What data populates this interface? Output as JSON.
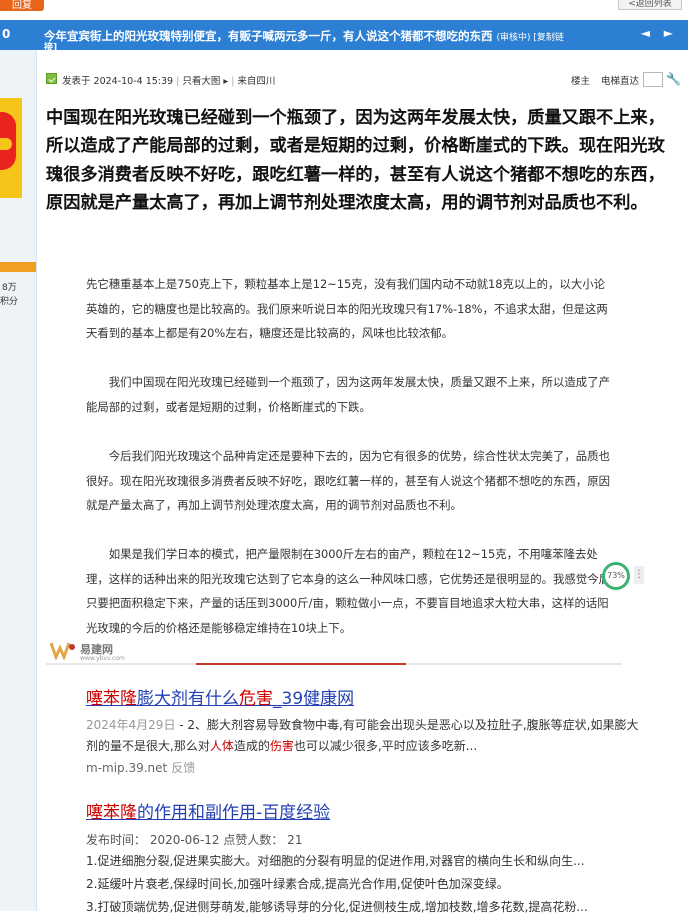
{
  "topbar": {
    "reply_label": "回复",
    "back_label": "<返回列表"
  },
  "titlebar": {
    "num": "0",
    "title": "今年宜宾街上的阳光玫瑰特别便宜，有贩子喊两元多一斤，有人说这个猪都不想吃的东西",
    "tag": "(审核中) [复制链",
    "title_wrap": "接]",
    "arrows": "◄ ►"
  },
  "author": {
    "rank_label": "",
    "stat1": "8万",
    "stat2": "积分"
  },
  "meta": {
    "posted": "发表于 2024-10-4 15:39",
    "only_image": "只看大图 ▸",
    "from": "来自四川",
    "floor": "楼主",
    "jump": "电梯直达"
  },
  "lead_text": "中国现在阳光玫瑰已经碰到一个瓶颈了，因为这两年发展太快，质量又跟不上来，所以造成了产能局部的过剩，或者是短期的过剩，价格断崖式的下跌。现在阳光玫瑰很多消费者反映不好吃，跟吃红薯一样的，甚至有人说这个猪都不想吃的东西，原因就是产量太高了，再加上调节剂处理浓度太高，用的调节剂对品质也不利。",
  "image": {
    "p1": "先它穗重基本上是750克上下，颗粒基本上是12~15克，没有我们国内动不动就18克以上的，以大小论英雄的，它的糖度也是比较高的。我们原来听说日本的阳光玫瑰只有17%-18%，不追求太甜，但是这两天看到的基本上都是有20%左右，糖度还是比较高的，风味也比较浓郁。",
    "p2": "　　我们中国现在阳光玫瑰已经碰到一个瓶颈了，因为这两年发展太快，质量又跟不上来，所以造成了产能局部的过剩，或者是短期的过剩，价格断崖式的下跌。",
    "p3": "　　今后我们阳光玫瑰这个品种肯定还是要种下去的，因为它有很多的优势，综合性状太完美了，品质也很好。现在阳光玫瑰很多消费者反映不好吃，跟吃红薯一样的，甚至有人说这个猪都不想吃的东西，原因就是产量太高了，再加上调节剂处理浓度太高，用的调节剂对品质也不利。",
    "p4": "　　如果是我们学日本的模式，把产量限制在3000斤左右的亩产，颗粒在12~15克，不用噻苯隆去处理，这样的话种出来的阳光玫瑰它达到了它本身的这么一种风味口感，它优势还是很明显的。我感觉今后只要把面积稳定下来，产量的话压到3000斤/亩，颗粒做小一点，不要盲目地追求大粒大串，这样的话阳光玫瑰的今后的价格还是能够稳定维持在10块上下。",
    "progress": "73%",
    "progress_value": 73,
    "more": "⋮",
    "wm_name": "易建网",
    "wm_url": "www.ybvv.com"
  },
  "results": [
    {
      "title_hl1": "噻苯隆",
      "title_mid": "膨大剂有什么",
      "title_hl2": "危害",
      "title_end": "_39健康网",
      "date": "2024年4月29日",
      "body_a": " - 2、膨大剂容易导致食物中毒,有可能会出现头是恶心以及拉肚子,腹胀等症状,如果膨大剂的量不是很大,那么对",
      "body_hl1": "人体",
      "body_b": "造成的",
      "body_hl2": "伤害",
      "body_c": "也可以减少很多,平时应该多吃新...",
      "source": "m-mip.39.net",
      "feedback": "反馈"
    },
    {
      "title_hl1": "噻苯隆",
      "title_mid": "的作用和副作用-百度经验",
      "publish": "发布时间：  2020-06-12      点赞人数：  21",
      "line1": "1.促进细胞分裂,促进果实膨大。对细胞的分裂有明显的促进作用,对器官的横向生长和纵向生...",
      "line2": "2.延缓叶片衰老,保绿时间长,加强叶绿素合成,提高光合作用,促使叶色加深变绿。",
      "line3": "3.打破顶端优势,促进侧芽萌发,能够诱导芽的分化,促进侧枝生成,增加枝数,增多花数,提高花粉..."
    }
  ]
}
